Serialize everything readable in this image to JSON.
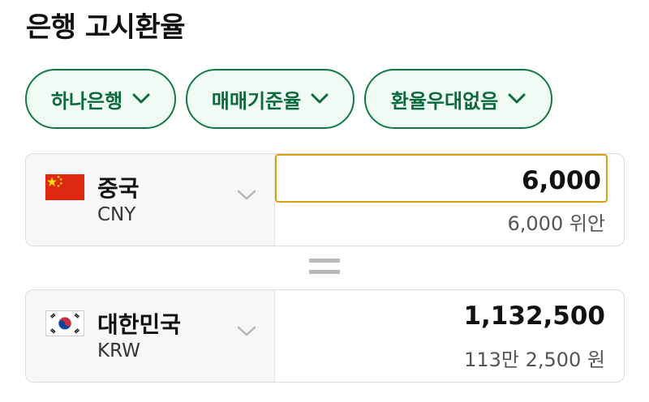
{
  "header": {
    "title": "은행 고시환율"
  },
  "filters": [
    {
      "label": "하나은행",
      "icon": "chevron-down-icon"
    },
    {
      "label": "매매기준율",
      "icon": "chevron-down-icon"
    },
    {
      "label": "환율우대없음",
      "icon": "chevron-down-icon"
    }
  ],
  "converter": {
    "from": {
      "country": "중국",
      "code": "CNY",
      "flag_icon": "china-flag-icon",
      "amount": "6,000",
      "amount_korean": "6,000 위안"
    },
    "equals_icon": "equals-icon",
    "to": {
      "country": "대한민국",
      "code": "KRW",
      "flag_icon": "korea-flag-icon",
      "amount": "1,132,500",
      "amount_korean": "113만 2,500 원"
    }
  },
  "colors": {
    "accent_green": "#0f7a45",
    "chip_background": "#f1fbf5",
    "input_focus_border": "#d9a20f",
    "china_flag_red": "#de2910",
    "china_flag_yellow": "#ffde00"
  }
}
